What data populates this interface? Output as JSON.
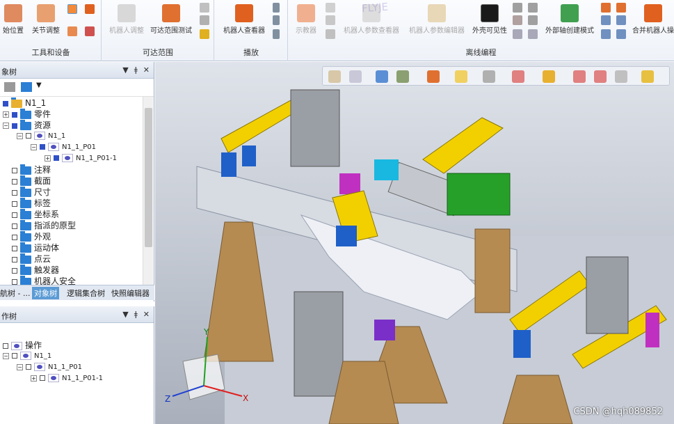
{
  "ribbon": {
    "groups": [
      {
        "label": "工具和设备",
        "buttons": [
          "始位置",
          "关节调整"
        ]
      },
      {
        "label": "可达范围",
        "buttons": [
          "机器人调整",
          "可达范围测试"
        ]
      },
      {
        "label": "播放",
        "buttons": [
          "机器人查看器"
        ]
      },
      {
        "label": "离线编程",
        "buttons": [
          "示教器",
          "机器人参数查看器",
          "机器人参数编辑器",
          "外壳可见性",
          "外部轴创建模式",
          "合并机器人操"
        ]
      }
    ],
    "watermark": "FLYJE"
  },
  "object_tree": {
    "title": "象树",
    "root": "N1_1",
    "items": [
      {
        "label": "零件",
        "checked": true,
        "expandable": true
      },
      {
        "label": "资源",
        "checked": true,
        "expandable": true
      },
      {
        "label": "N1_1",
        "checked": false
      },
      {
        "label": "N1_1_P01",
        "checked": true
      },
      {
        "label": "N1_1_P01-1",
        "checked": true
      },
      {
        "label": "注释",
        "checked": false
      },
      {
        "label": "截面",
        "checked": false
      },
      {
        "label": "尺寸",
        "checked": false
      },
      {
        "label": "标签",
        "checked": false
      },
      {
        "label": "坐标系",
        "checked": false
      },
      {
        "label": "指派的原型",
        "checked": false
      },
      {
        "label": "外观",
        "checked": false
      },
      {
        "label": "运动体",
        "checked": false
      },
      {
        "label": "点云",
        "checked": false
      },
      {
        "label": "触发器",
        "checked": false
      },
      {
        "label": "机器人安全",
        "checked": false
      }
    ],
    "tabs": [
      "航树 - ...",
      "对象树",
      "逻辑集合树",
      "快照编辑器"
    ],
    "active_tab": "对象树"
  },
  "operation_tree": {
    "title": "作树",
    "items": [
      "操作",
      "N1_1",
      "N1_1_P01",
      "N1_1_P01-1"
    ]
  },
  "viewport": {
    "axes": {
      "x": "X",
      "y": "Y",
      "z": "Z"
    },
    "credit": "CSDN @hqh089852"
  },
  "colors": {
    "ribbon_bg": "#eef2f8",
    "folder": "#2b7fd4",
    "active_tab": "#5b9bd5",
    "yellow": "#f2d000",
    "blue": "#1f5fc8",
    "wood": "#b58b52",
    "green": "#27a02a",
    "magenta": "#c030c0",
    "cyan": "#18b8e0"
  }
}
